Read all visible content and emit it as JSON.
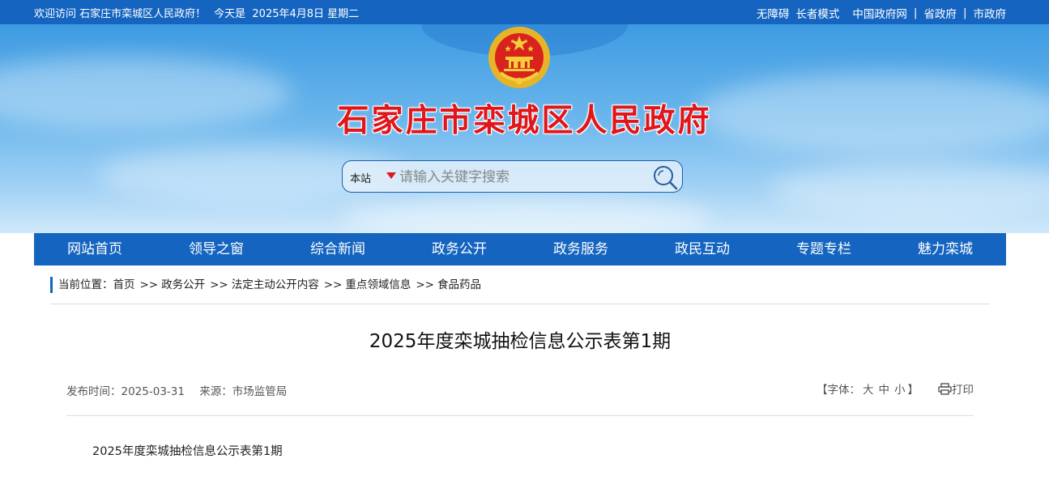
{
  "topbar": {
    "welcome": "欢迎访问 石家庄市栾城区人民政府！",
    "date": "今天是  2025年4月8日 星期二",
    "links": [
      "无障碍",
      "长者模式",
      "中国政府网",
      "省政府",
      "市政府"
    ],
    "separator": "|"
  },
  "header": {
    "site_title": "石家庄市栾城区人民政府",
    "emblem_icon": "national-emblem-icon"
  },
  "search": {
    "scope": "本站",
    "placeholder": "请输入关键字搜索",
    "icon": "search-icon"
  },
  "nav": {
    "items": [
      "网站首页",
      "领导之窗",
      "综合新闻",
      "政务公开",
      "政务服务",
      "政民互动",
      "专题专栏",
      "魅力栾城"
    ]
  },
  "breadcrumb": {
    "label": "当前位置：",
    "arrow": ">>",
    "items": [
      "首页",
      "政务公开",
      "法定主动公开内容",
      "重点领域信息",
      "食品药品"
    ]
  },
  "article": {
    "title": "2025年度栾城抽检信息公示表第1期",
    "publish_label": "发布时间：",
    "publish_date": "2025-03-31",
    "source_label": "来源：",
    "source": "市场监管局",
    "font_label_open": "【字体：",
    "font_sizes": [
      "大",
      "中",
      "小"
    ],
    "font_label_close": "】",
    "print_label": "打印",
    "body_first_line": "2025年度栾城抽检信息公示表第1期"
  },
  "colors": {
    "primary_blue": "#1565c0",
    "title_red": "#e0161a"
  }
}
